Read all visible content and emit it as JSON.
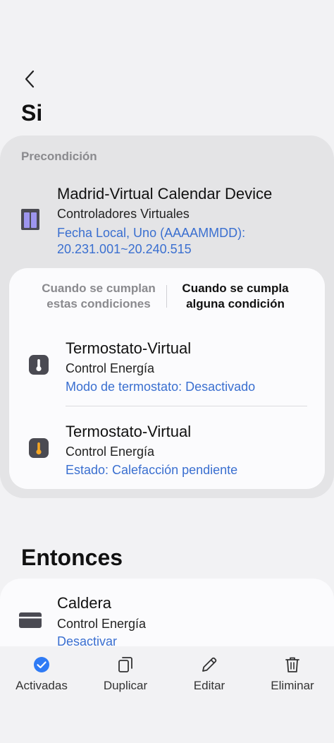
{
  "header": {
    "title": "Si",
    "back_icon": "chevron-left-icon"
  },
  "precondition": {
    "label": "Precondición",
    "device": {
      "icon": "calendar-device-icon",
      "name": "Madrid-Virtual Calendar Device",
      "group": "Controladores Virtuales",
      "status_line1": "Fecha Local, Uno (AAAAMMDD):",
      "status_line2": "20.231.001~20.240.515"
    }
  },
  "condition_mode": {
    "all_line1": "Cuando se cumplan",
    "all_line2": "estas condiciones",
    "any_line1": "Cuando se cumpla",
    "any_line2": "alguna condición",
    "selected": "any"
  },
  "conditions": [
    {
      "icon": "thermostat-icon",
      "name": "Termostato-Virtual",
      "group": "Control Energía",
      "status": "Modo de termostato: Desactivado"
    },
    {
      "icon": "thermostat-heating-icon",
      "name": "Termostato-Virtual",
      "group": "Control Energía",
      "status": "Estado: Calefacción pendiente"
    }
  ],
  "then": {
    "title": "Entonces",
    "action": {
      "icon": "boiler-icon",
      "name": "Caldera",
      "group": "Control Energía",
      "status": "Desactivar"
    }
  },
  "bottom_bar": [
    {
      "label": "Activadas",
      "icon": "check-circle-icon"
    },
    {
      "label": "Duplicar",
      "icon": "duplicate-icon"
    },
    {
      "label": "Editar",
      "icon": "pencil-icon"
    },
    {
      "label": "Eliminar",
      "icon": "trash-icon"
    }
  ],
  "colors": {
    "accent_blue": "#3a6fd0",
    "check_blue": "#2f7bf5",
    "calendar_purple": "#9d95ee",
    "thermo_orange": "#f5a623"
  }
}
